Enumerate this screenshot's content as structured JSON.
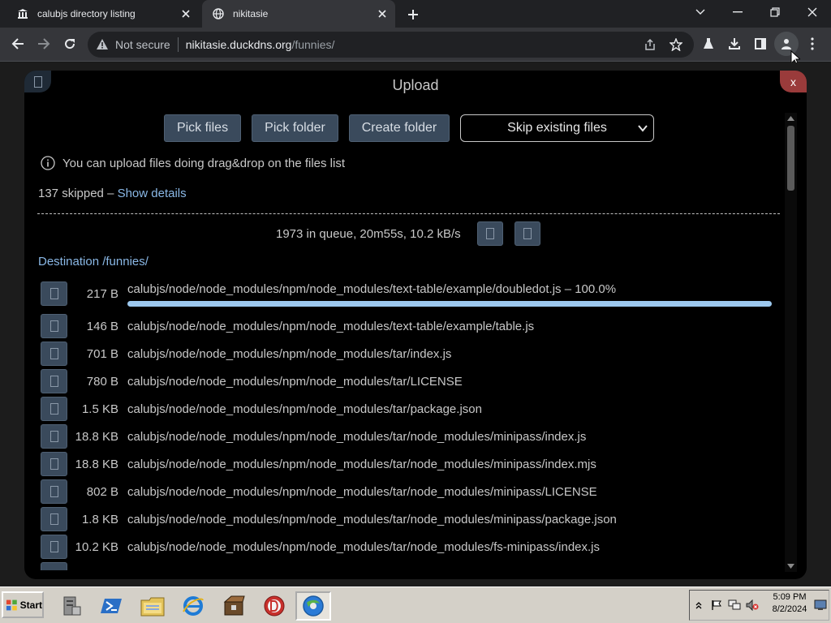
{
  "browser": {
    "tabs": [
      {
        "title": "calubjs directory listing",
        "icon": "bank-icon"
      },
      {
        "title": "nikitasie",
        "icon": "globe-icon"
      }
    ],
    "address": {
      "security": "Not secure",
      "host": "nikitasie.duckdns.org",
      "path": "/funnies/"
    }
  },
  "upload": {
    "title": "Upload",
    "close_label": "x",
    "buttons": {
      "pick_files": "Pick files",
      "pick_folder": "Pick folder",
      "create_folder": "Create folder"
    },
    "select": {
      "value": "Skip existing files"
    },
    "hint": "You can upload files doing drag&drop on the files list",
    "skipped_text": "137 skipped – ",
    "skipped_link": "Show details",
    "queue_text": "1973 in queue, 20m55s, 10.2 kB/s",
    "destination": "Destination /funnies/",
    "files": [
      {
        "size": "217 B",
        "name": "calubjs/node/node_modules/npm/node_modules/text-table/example/doubledot.js",
        "status": " – 100.0%",
        "progress": 1.0
      },
      {
        "size": "146 B",
        "name": "calubjs/node/node_modules/npm/node_modules/text-table/example/table.js"
      },
      {
        "size": "701 B",
        "name": "calubjs/node/node_modules/npm/node_modules/tar/index.js"
      },
      {
        "size": "780 B",
        "name": "calubjs/node/node_modules/npm/node_modules/tar/LICENSE"
      },
      {
        "size": "1.5 KB",
        "name": "calubjs/node/node_modules/npm/node_modules/tar/package.json"
      },
      {
        "size": "18.8 KB",
        "name": "calubjs/node/node_modules/npm/node_modules/tar/node_modules/minipass/index.js"
      },
      {
        "size": "18.8 KB",
        "name": "calubjs/node/node_modules/npm/node_modules/tar/node_modules/minipass/index.mjs"
      },
      {
        "size": "802 B",
        "name": "calubjs/node/node_modules/npm/node_modules/tar/node_modules/minipass/LICENSE"
      },
      {
        "size": "1.8 KB",
        "name": "calubjs/node/node_modules/npm/node_modules/tar/node_modules/minipass/package.json"
      },
      {
        "size": "10.2 KB",
        "name": "calubjs/node/node_modules/npm/node_modules/tar/node_modules/fs-minipass/index.js"
      }
    ]
  },
  "taskbar": {
    "start_label": "Start",
    "time": "5:09 PM",
    "date": "8/2/2024"
  },
  "colors": {
    "accent_link": "#8ab8e6",
    "button_bg": "#3a4a5c",
    "close_red": "#9a3b3b",
    "progress": "#9cc8ee"
  }
}
